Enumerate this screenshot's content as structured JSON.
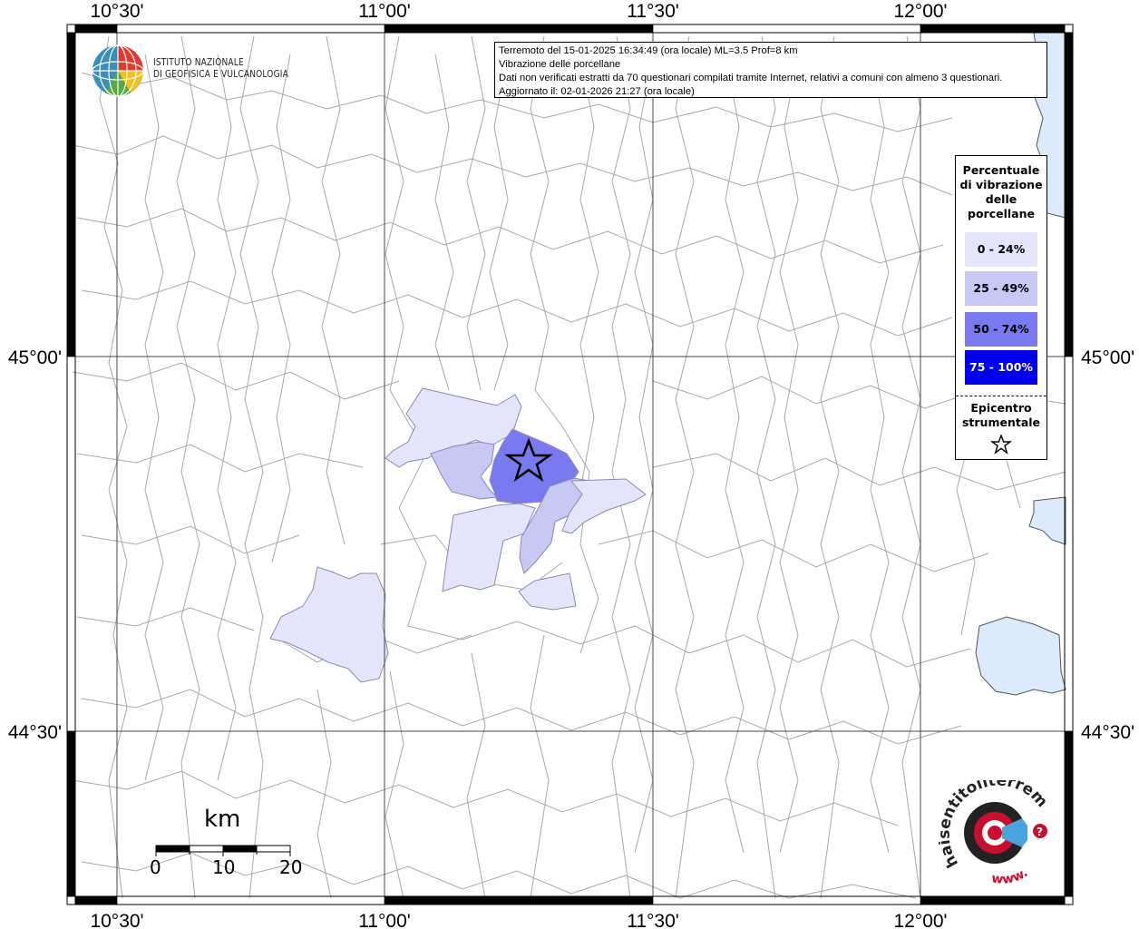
{
  "map": {
    "lon_labels": [
      "10°30'",
      "11°00'",
      "11°30'",
      "12°00'"
    ],
    "lat_labels": [
      "45°00'",
      "44°30'"
    ]
  },
  "info": {
    "line1": "Terremoto del 15-01-2025 16:34:49 (ora locale) ML=3.5 Prof=8 km",
    "line2": "Vibrazione delle porcellane",
    "line3": "Dati non verificati estratti da 70 questionari compilati tramite Internet, relativi a comuni con almeno 3 questionari.",
    "line4": "Aggiornato il: 02-01-2026 21:27 (ora locale)"
  },
  "legend": {
    "title_lines": [
      "Percentuale",
      "di vibrazione",
      "delle",
      "porcellane"
    ],
    "items": [
      {
        "label": "0 - 24%",
        "color": "#e4e4fa"
      },
      {
        "label": "25 - 49%",
        "color": "#c8c8f5"
      },
      {
        "label": "50 - 74%",
        "color": "#7a7af0"
      },
      {
        "label": "75 - 100%",
        "color": "#0000ee"
      }
    ],
    "epicenter_lines": [
      "Epicentro",
      "strumentale"
    ]
  },
  "logo": {
    "line1": "ISTITUTO NAZIONALE",
    "line2": "DI GEOFISICA E VULCANOLOGIA"
  },
  "scale": {
    "unit": "km",
    "labels": [
      "0",
      "10",
      "20"
    ]
  },
  "hsit_logo": {
    "text": "haisentitoilterremoto.it",
    "www": "www."
  },
  "colors": {
    "water": "#dcebfb",
    "border": "#a8a8a8",
    "grid": "#444444"
  }
}
